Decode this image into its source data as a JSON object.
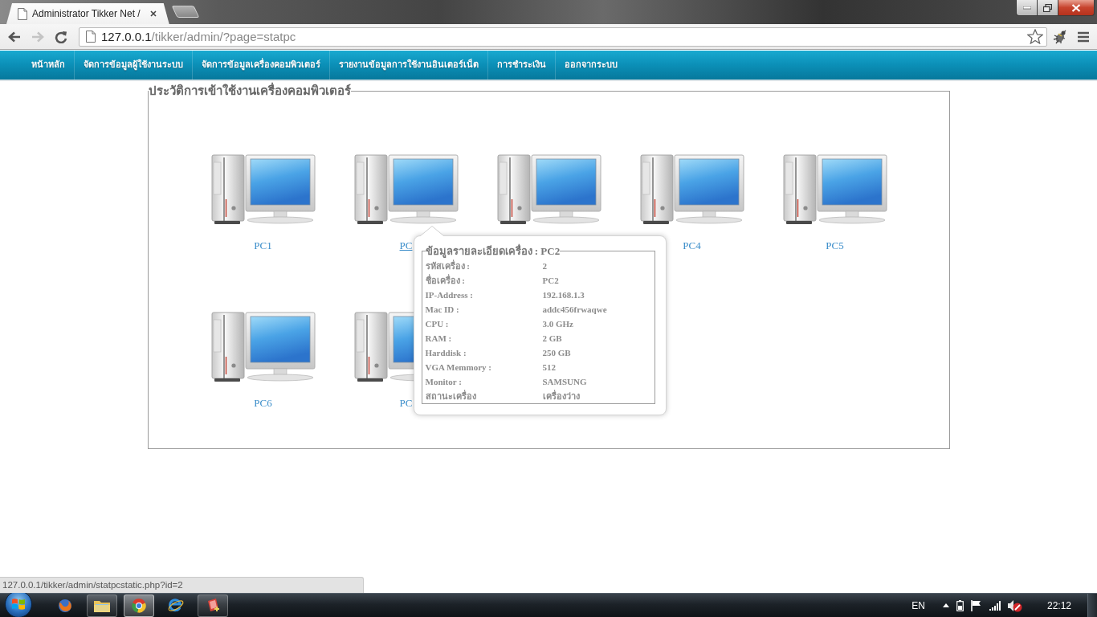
{
  "browser": {
    "tab_title": "Administrator Tikker Net /",
    "url_host": "127.0.0.1",
    "url_path": "/tikker/admin/?page=statpc",
    "back_disabled": false,
    "forward_disabled": true
  },
  "nav": {
    "items": [
      "หน้าหลัก",
      "จัดการข้อมูลผู้ใช้งานระบบ",
      "จัดการข้อมูลเครื่องคอมพิวเตอร์",
      "รายงานข้อมูลการใช้งานอินเตอร์เน็ต",
      "การชำระเงิน",
      "ออกจากระบบ"
    ]
  },
  "panel": {
    "legend": "ประวัติการเข้าใช้งานเครื่องคอมพิวเตอร์",
    "computers": [
      {
        "kind": "desktop",
        "label": "PC1",
        "hovered": false
      },
      {
        "kind": "desktop",
        "label": "PC",
        "hovered": true
      },
      {
        "kind": "desktop"
      },
      {
        "kind": "desktop",
        "label": "PC4",
        "hovered": false
      },
      {
        "kind": "desktop",
        "label": "PC5",
        "hovered": false
      },
      {
        "kind": "desktop",
        "label": "PC6",
        "hovered": false
      },
      {
        "kind": "desktop",
        "label": "PC",
        "hovered": false
      }
    ]
  },
  "tooltip": {
    "legend": "ข้อมูลรายละเอียดเครื่อง : PC2",
    "rows": [
      {
        "label": "รหัสเครื่อง :",
        "value": "2"
      },
      {
        "label": "ชื่อเครื่อง :",
        "value": "PC2"
      },
      {
        "label": "IP-Address :",
        "value": "192.168.1.3"
      },
      {
        "label": "Mac ID :",
        "value": "addc456frwaqwe"
      },
      {
        "label": "CPU :",
        "value": "3.0 GHz"
      },
      {
        "label": "RAM :",
        "value": "2 GB"
      },
      {
        "label": "Harddisk :",
        "value": "250 GB"
      },
      {
        "label": "VGA Memmory :",
        "value": "512"
      },
      {
        "label": "Monitor :",
        "value": "SAMSUNG"
      },
      {
        "label": "สถานะเครื่อง",
        "value": "เครื่องว่าง"
      }
    ]
  },
  "status_url": "127.0.0.1/tikker/admin/statpcstatic.php?id=2",
  "taskbar": {
    "apps": [
      {
        "kind": "fox",
        "open": false,
        "selected": false
      },
      {
        "kind": "folder",
        "open": true,
        "selected": false
      },
      {
        "kind": "ball",
        "open": true,
        "selected": true
      },
      {
        "kind": "e",
        "open": false,
        "selected": false
      },
      {
        "kind": "doc",
        "open": true,
        "selected": false
      }
    ],
    "language": "EN",
    "clock": "22:12"
  }
}
